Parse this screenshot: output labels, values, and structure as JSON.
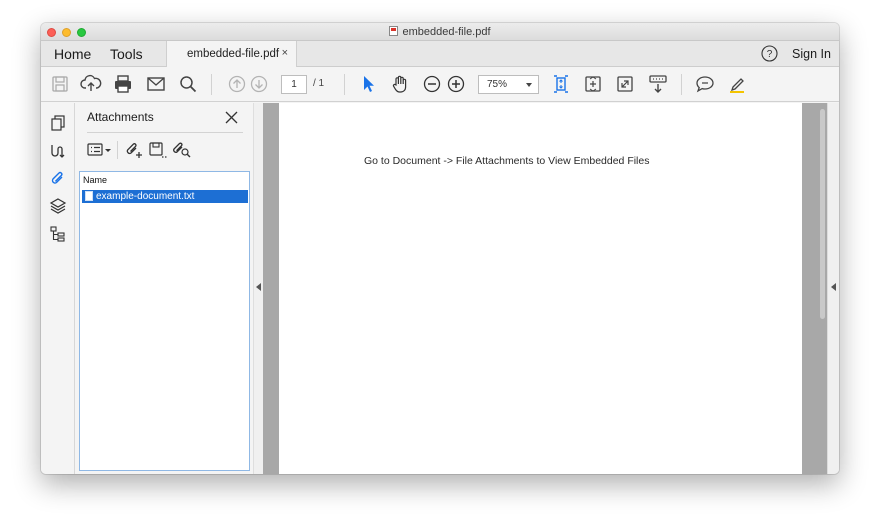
{
  "window": {
    "title": "embedded-file.pdf"
  },
  "menu": {
    "home_label": "Home",
    "tools_label": "Tools",
    "doc_tab_label": "embedded-file.pdf",
    "doc_tab_close": "×",
    "sign_in_label": "Sign In"
  },
  "toolbar": {
    "page_current": "1",
    "page_total": "/ 1",
    "zoom_value": "75%",
    "accent_color": "#1a73e8"
  },
  "sidebar": {
    "icons": [
      "pages-icon",
      "signature-icon",
      "attachment-icon",
      "layers-icon",
      "tags-icon"
    ]
  },
  "attachments": {
    "title": "Attachments",
    "column_header": "Name",
    "files": [
      {
        "name": "example-document.txt",
        "selected": true
      }
    ]
  },
  "document": {
    "text": "Go to Document -> File Attachments to View Embedded Files"
  }
}
